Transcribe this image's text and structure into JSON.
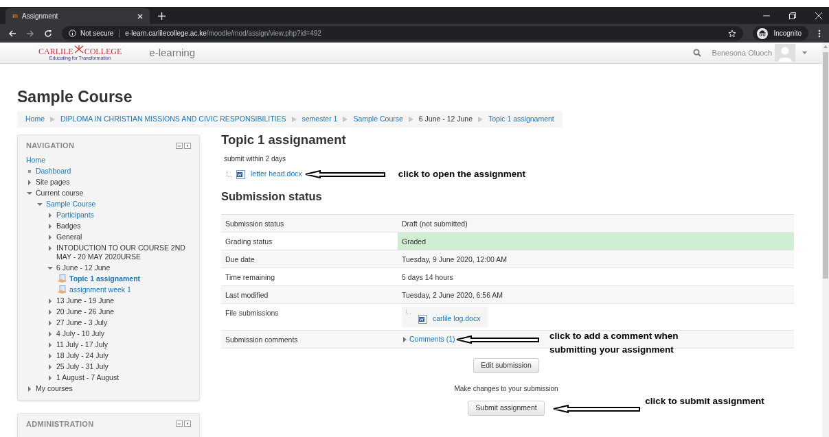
{
  "browser": {
    "tab": {
      "title": "Assignment",
      "favicon": "ın"
    },
    "security": "Not secure",
    "url_host": "e-learn.carlilecollege.ac.ke",
    "url_path": "/moodle/mod/assign/view.php?id=492",
    "profile": "Incognito"
  },
  "header": {
    "logo": {
      "name": "CARLILE",
      "name2": "COLLEGE",
      "tagline": "Educating for Transformation"
    },
    "site_name": "e-learning",
    "user": "Benesona Oluoch"
  },
  "page_title": "Sample Course",
  "breadcrumb": [
    {
      "label": "Home",
      "link": true
    },
    {
      "label": "DIPLOMA IN CHRISTIAN MISSIONS AND CIVIC RESPONSIBILITIES",
      "link": true
    },
    {
      "label": "semester 1",
      "link": true
    },
    {
      "label": "Sample Course",
      "link": true
    },
    {
      "label": "6 June - 12 June",
      "link": false
    },
    {
      "label": "Topic 1 assignament",
      "link": true
    }
  ],
  "navigation": {
    "title": "NAVIGATION",
    "items": [
      {
        "label": "Home",
        "kind": "home",
        "link": true
      },
      {
        "label": "Dashboard",
        "kind": "page",
        "link": true
      },
      {
        "label": "Site pages",
        "kind": "folder",
        "link": false,
        "expanded": false
      },
      {
        "label": "Current course",
        "kind": "folder",
        "link": false,
        "expanded": true,
        "children": [
          {
            "label": "Sample Course",
            "kind": "folder",
            "link": true,
            "expanded": true,
            "children": [
              {
                "label": "Participants",
                "kind": "folder",
                "link": true,
                "expanded": false
              },
              {
                "label": "Badges",
                "kind": "folder",
                "link": false,
                "expanded": false
              },
              {
                "label": "General",
                "kind": "folder",
                "link": false,
                "expanded": false
              },
              {
                "label": "INTODUCTION TO OUR COURSE 2ND MAY - 20 MAY 2020URSE",
                "kind": "folder",
                "link": false,
                "expanded": false
              },
              {
                "label": "6 June - 12 June",
                "kind": "folder",
                "link": false,
                "expanded": true,
                "children": [
                  {
                    "label": "Topic 1 assignament",
                    "kind": "activity",
                    "link": true,
                    "current": true
                  },
                  {
                    "label": "assignment week 1",
                    "kind": "activity",
                    "link": true,
                    "current": false
                  }
                ]
              },
              {
                "label": "13 June - 19 June",
                "kind": "folder",
                "link": false,
                "expanded": false
              },
              {
                "label": "20 June - 26 June",
                "kind": "folder",
                "link": false,
                "expanded": false
              },
              {
                "label": "27 June - 3 July",
                "kind": "folder",
                "link": false,
                "expanded": false
              },
              {
                "label": "4 July - 10 July",
                "kind": "folder",
                "link": false,
                "expanded": false
              },
              {
                "label": "11 July - 17 July",
                "kind": "folder",
                "link": false,
                "expanded": false
              },
              {
                "label": "18 July - 24 July",
                "kind": "folder",
                "link": false,
                "expanded": false
              },
              {
                "label": "25 July - 31 July",
                "kind": "folder",
                "link": false,
                "expanded": false
              },
              {
                "label": "1 August - 7 August",
                "kind": "folder",
                "link": false,
                "expanded": false
              }
            ]
          }
        ]
      },
      {
        "label": "My courses",
        "kind": "folder",
        "link": false,
        "expanded": false
      }
    ]
  },
  "administration": {
    "title": "ADMINISTRATION"
  },
  "assignment": {
    "title": "Topic 1 assignament",
    "description": "submit within 2 days",
    "file": "letter head.docx",
    "file_note": "click to open the assignment"
  },
  "submission": {
    "title": "Submission status",
    "rows": [
      {
        "label": "Submission status",
        "value": "Draft (not submitted)",
        "kind": "text",
        "highlight": false
      },
      {
        "label": "Grading status",
        "value": "Graded",
        "kind": "text",
        "highlight": true
      },
      {
        "label": "Due date",
        "value": "Tuesday, 9 June 2020, 12:00 AM",
        "kind": "text",
        "highlight": false
      },
      {
        "label": "Time remaining",
        "value": "5 days 14 hours",
        "kind": "text",
        "highlight": false
      },
      {
        "label": "Last modified",
        "value": "Tuesday, 2 June 2020, 6:56 AM",
        "kind": "text",
        "highlight": false
      },
      {
        "label": "File submissions",
        "value": "carlile log.docx",
        "kind": "file",
        "highlight": false
      },
      {
        "label": "Submission comments",
        "value": "Comments (1)",
        "kind": "comments",
        "highlight": false,
        "expanded": false,
        "note": "click to add a comment when submitting your assignment"
      }
    ],
    "edit_button": "Edit submission",
    "hint": "Make changes to your submission",
    "submit_button": "Submit assignment",
    "submit_note": "click to submit assignment"
  }
}
